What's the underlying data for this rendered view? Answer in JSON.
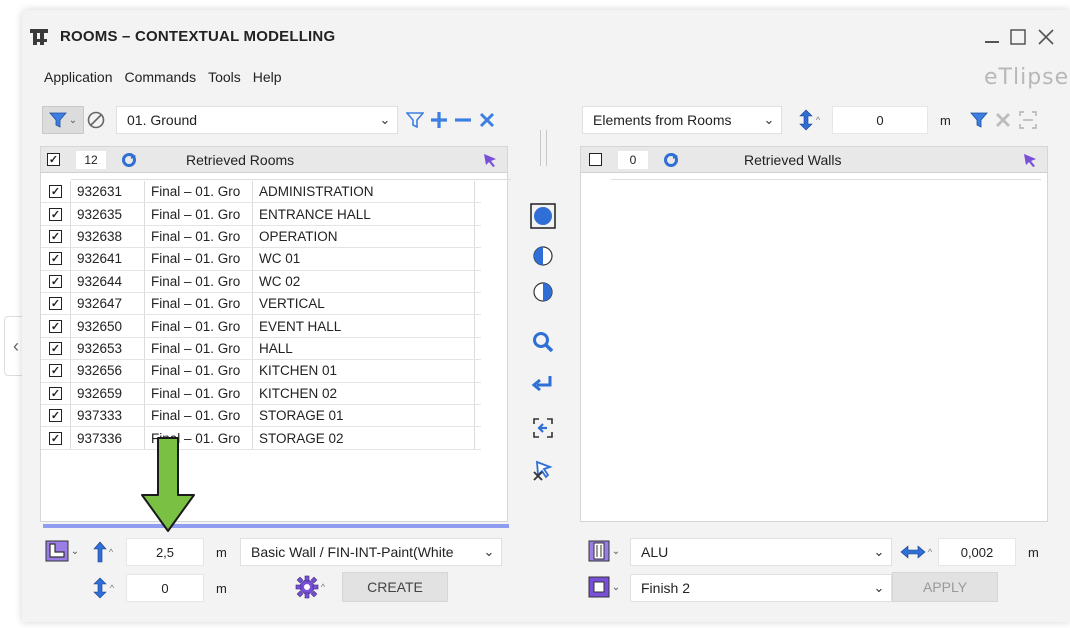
{
  "window": {
    "title": "ROOMS – CONTEXTUAL MODELLING",
    "logo_text": "eTlipse",
    "controls": [
      "minimize",
      "maximize",
      "close"
    ]
  },
  "menu": [
    "Application",
    "Commands",
    "Tools",
    "Help"
  ],
  "left": {
    "level_select": "01. Ground",
    "header": {
      "count": "12",
      "title": "Retrieved Rooms"
    },
    "rooms": [
      {
        "id": "932631",
        "level": "Final – 01. Gro",
        "name": "ADMINISTRATION",
        "checked": true
      },
      {
        "id": "932635",
        "level": "Final – 01. Gro",
        "name": "ENTRANCE HALL",
        "checked": true
      },
      {
        "id": "932638",
        "level": "Final – 01. Gro",
        "name": "OPERATION",
        "checked": true
      },
      {
        "id": "932641",
        "level": "Final – 01. Gro",
        "name": "WC 01",
        "checked": true
      },
      {
        "id": "932644",
        "level": "Final – 01. Gro",
        "name": "WC 02",
        "checked": true
      },
      {
        "id": "932647",
        "level": "Final – 01. Gro",
        "name": "VERTICAL",
        "checked": true
      },
      {
        "id": "932650",
        "level": "Final – 01. Gro",
        "name": "EVENT HALL",
        "checked": true
      },
      {
        "id": "932653",
        "level": "Final – 01. Gro",
        "name": "HALL",
        "checked": true
      },
      {
        "id": "932656",
        "level": "Final – 01. Gro",
        "name": "KITCHEN 01",
        "checked": true
      },
      {
        "id": "932659",
        "level": "Final – 01. Gro",
        "name": "KITCHEN 02",
        "checked": true
      },
      {
        "id": "937333",
        "level": "Final – 01. Gro",
        "name": "STORAGE 01",
        "checked": true
      },
      {
        "id": "937336",
        "level": "Final – 01. Gro",
        "name": "STORAGE 02",
        "checked": true
      }
    ],
    "bottom": {
      "height_value": "2,5",
      "height_unit": "m",
      "wall_type": "Basic Wall / FIN-INT-Paint(White",
      "offset_value": "0",
      "offset_unit": "m",
      "create_label": "CREATE"
    }
  },
  "right": {
    "source_select": "Elements from Rooms",
    "offset_value": "0",
    "offset_unit": "m",
    "header": {
      "count": "0",
      "title": "Retrieved Walls"
    },
    "bottom": {
      "material": "ALU",
      "thickness_value": "0,002",
      "thickness_unit": "m",
      "finish": "Finish 2",
      "apply_label": "APPLY"
    }
  },
  "sidebar_toggle": "‹",
  "colors": {
    "accent_blue": "#2f6fd6",
    "filter_blue": "#3d7fe0",
    "purple": "#7a4fd8",
    "arrow_green": "#7ac143",
    "progress": "#8f9cf0"
  }
}
